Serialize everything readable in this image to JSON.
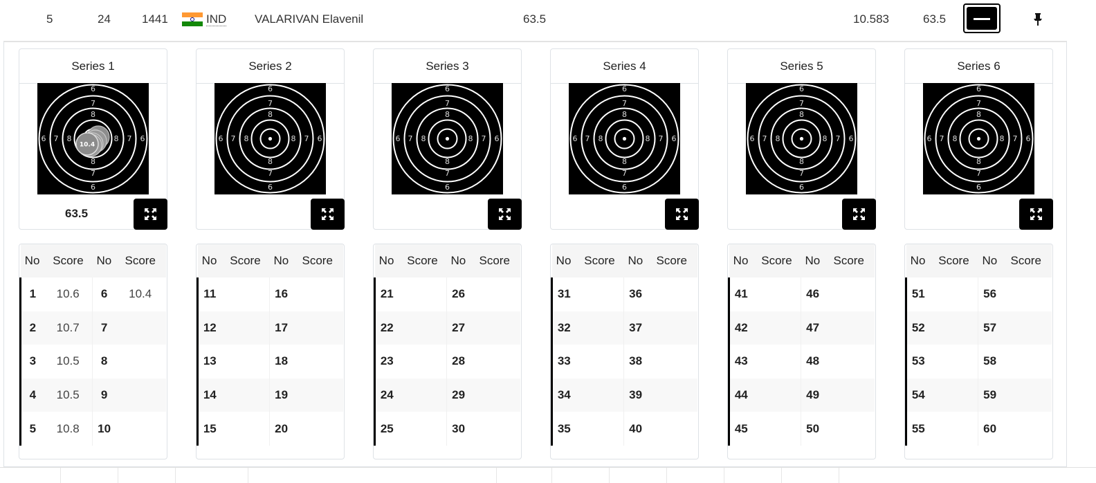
{
  "row": {
    "rank": "5",
    "bib": "24",
    "id": "1441",
    "noc": "IND",
    "name": "VALARIVAN Elavenil",
    "total": "63.5",
    "average": "10.583",
    "score": "63.5"
  },
  "colors": {
    "flag_saffron": "#ff9933",
    "flag_green": "#138808",
    "target_black": "#000000",
    "button_black": "#000000"
  },
  "table_headers": {
    "no": "No",
    "score": "Score"
  },
  "series": [
    {
      "title": "Series 1",
      "total": "63.5",
      "shot_label": "10.4",
      "rows": [
        {
          "no1": "1",
          "s1": "10.6",
          "no2": "6",
          "s2": "10.4"
        },
        {
          "no1": "2",
          "s1": "10.7",
          "no2": "7",
          "s2": ""
        },
        {
          "no1": "3",
          "s1": "10.5",
          "no2": "8",
          "s2": ""
        },
        {
          "no1": "4",
          "s1": "10.5",
          "no2": "9",
          "s2": ""
        },
        {
          "no1": "5",
          "s1": "10.8",
          "no2": "10",
          "s2": ""
        }
      ]
    },
    {
      "title": "Series 2",
      "total": "",
      "rows": [
        {
          "no1": "11",
          "s1": "",
          "no2": "16",
          "s2": ""
        },
        {
          "no1": "12",
          "s1": "",
          "no2": "17",
          "s2": ""
        },
        {
          "no1": "13",
          "s1": "",
          "no2": "18",
          "s2": ""
        },
        {
          "no1": "14",
          "s1": "",
          "no2": "19",
          "s2": ""
        },
        {
          "no1": "15",
          "s1": "",
          "no2": "20",
          "s2": ""
        }
      ]
    },
    {
      "title": "Series 3",
      "total": "",
      "rows": [
        {
          "no1": "21",
          "s1": "",
          "no2": "26",
          "s2": ""
        },
        {
          "no1": "22",
          "s1": "",
          "no2": "27",
          "s2": ""
        },
        {
          "no1": "23",
          "s1": "",
          "no2": "28",
          "s2": ""
        },
        {
          "no1": "24",
          "s1": "",
          "no2": "29",
          "s2": ""
        },
        {
          "no1": "25",
          "s1": "",
          "no2": "30",
          "s2": ""
        }
      ]
    },
    {
      "title": "Series 4",
      "total": "",
      "rows": [
        {
          "no1": "31",
          "s1": "",
          "no2": "36",
          "s2": ""
        },
        {
          "no1": "32",
          "s1": "",
          "no2": "37",
          "s2": ""
        },
        {
          "no1": "33",
          "s1": "",
          "no2": "38",
          "s2": ""
        },
        {
          "no1": "34",
          "s1": "",
          "no2": "39",
          "s2": ""
        },
        {
          "no1": "35",
          "s1": "",
          "no2": "40",
          "s2": ""
        }
      ]
    },
    {
      "title": "Series 5",
      "total": "",
      "rows": [
        {
          "no1": "41",
          "s1": "",
          "no2": "46",
          "s2": ""
        },
        {
          "no1": "42",
          "s1": "",
          "no2": "47",
          "s2": ""
        },
        {
          "no1": "43",
          "s1": "",
          "no2": "48",
          "s2": ""
        },
        {
          "no1": "44",
          "s1": "",
          "no2": "49",
          "s2": ""
        },
        {
          "no1": "45",
          "s1": "",
          "no2": "50",
          "s2": ""
        }
      ]
    },
    {
      "title": "Series 6",
      "total": "",
      "rows": [
        {
          "no1": "51",
          "s1": "",
          "no2": "56",
          "s2": ""
        },
        {
          "no1": "52",
          "s1": "",
          "no2": "57",
          "s2": ""
        },
        {
          "no1": "53",
          "s1": "",
          "no2": "58",
          "s2": ""
        },
        {
          "no1": "54",
          "s1": "",
          "no2": "59",
          "s2": ""
        },
        {
          "no1": "55",
          "s1": "",
          "no2": "60",
          "s2": ""
        }
      ]
    }
  ],
  "target_ring_labels": {
    "six": "6",
    "seven": "7",
    "eight": "8"
  },
  "icons": {
    "collapse": "minus-icon",
    "pin": "pin-icon",
    "expand": "expand-arrows-icon"
  }
}
